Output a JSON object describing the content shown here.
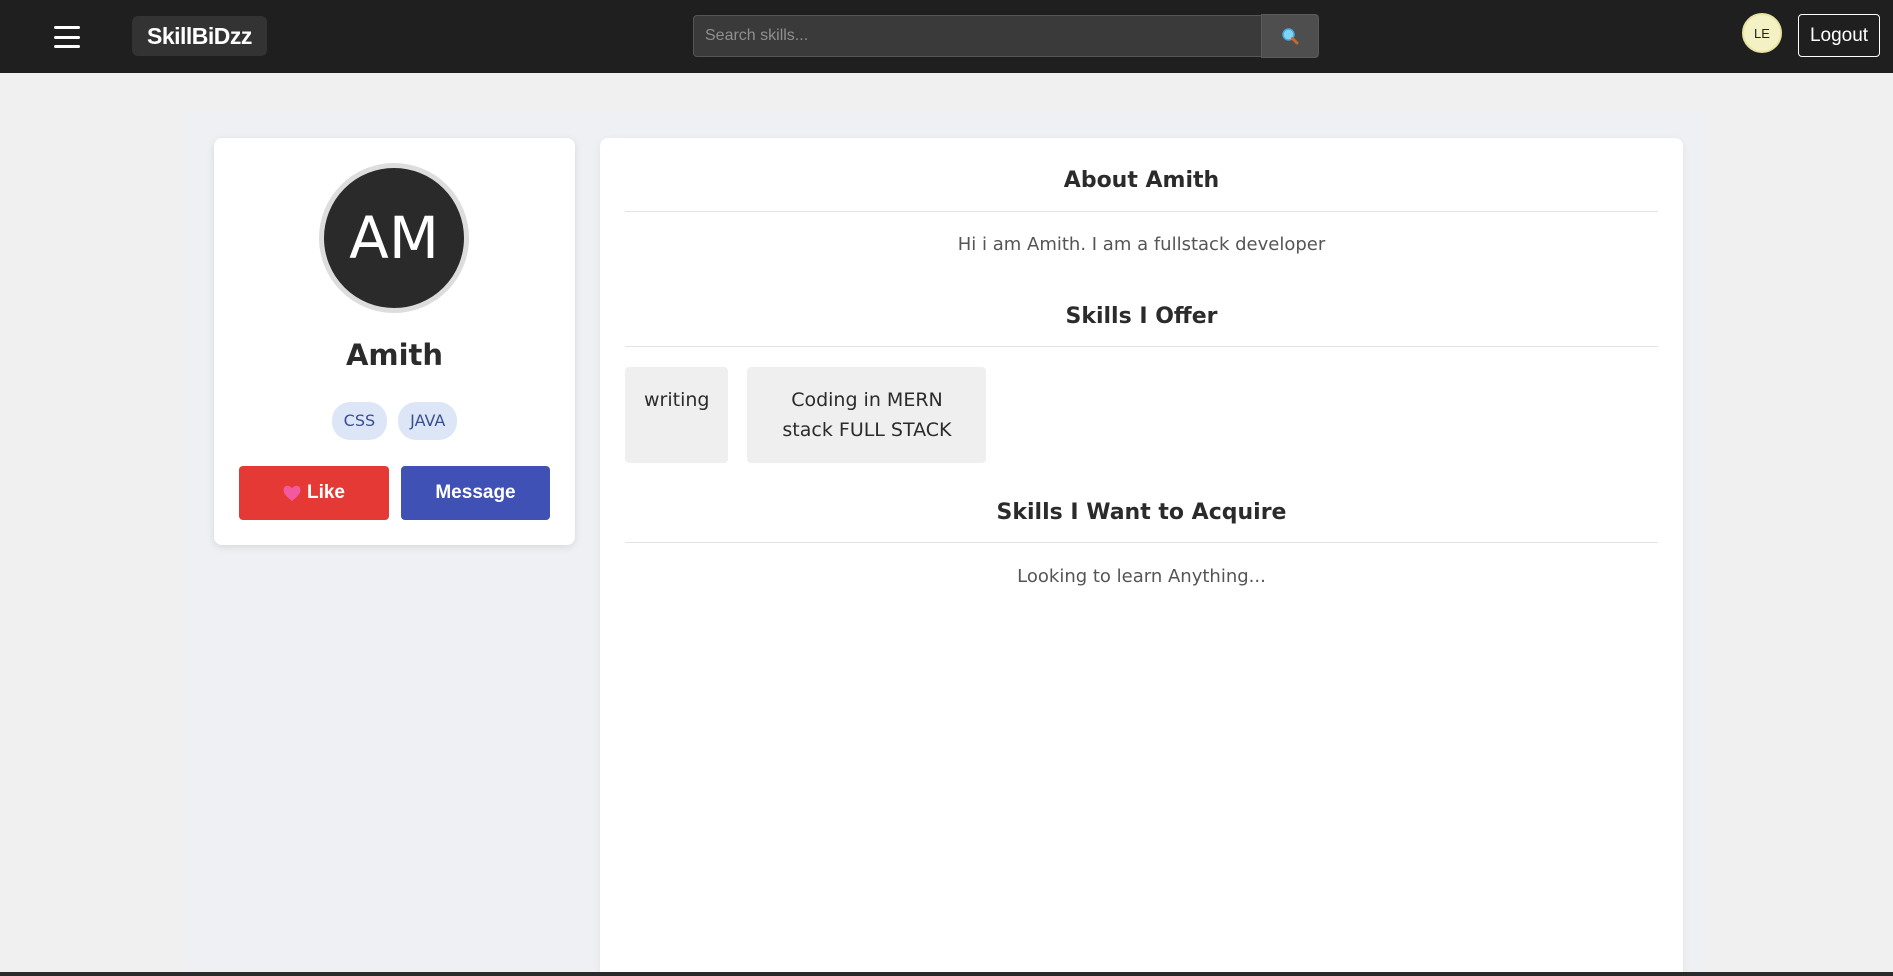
{
  "navbar": {
    "brand": "SkillBiDzz",
    "search_placeholder": "Search skills...",
    "user_initials": "LE",
    "logout_label": "Logout"
  },
  "profile": {
    "initials": "AM",
    "name": "Amith",
    "tags": [
      "CSS",
      "JAVA"
    ],
    "like_label": "Like",
    "message_label": "Message"
  },
  "about": {
    "title": "About Amith",
    "text": "Hi i am Amith. I am a fullstack developer"
  },
  "offer": {
    "title": "Skills I Offer",
    "items": [
      "writing",
      "Coding in MERN stack FULL STACK"
    ]
  },
  "acquire": {
    "title": "Skills I Want to Acquire",
    "text": "Looking to learn Anything..."
  },
  "colors": {
    "navbar_bg": "#1f1f1f",
    "like_button": "#e53935",
    "message_button": "#3f51b5",
    "tag_bg": "#dde6f7"
  },
  "icons": {
    "menu": "hamburger-icon",
    "search": "magnifier-icon",
    "like": "heart-icon"
  }
}
